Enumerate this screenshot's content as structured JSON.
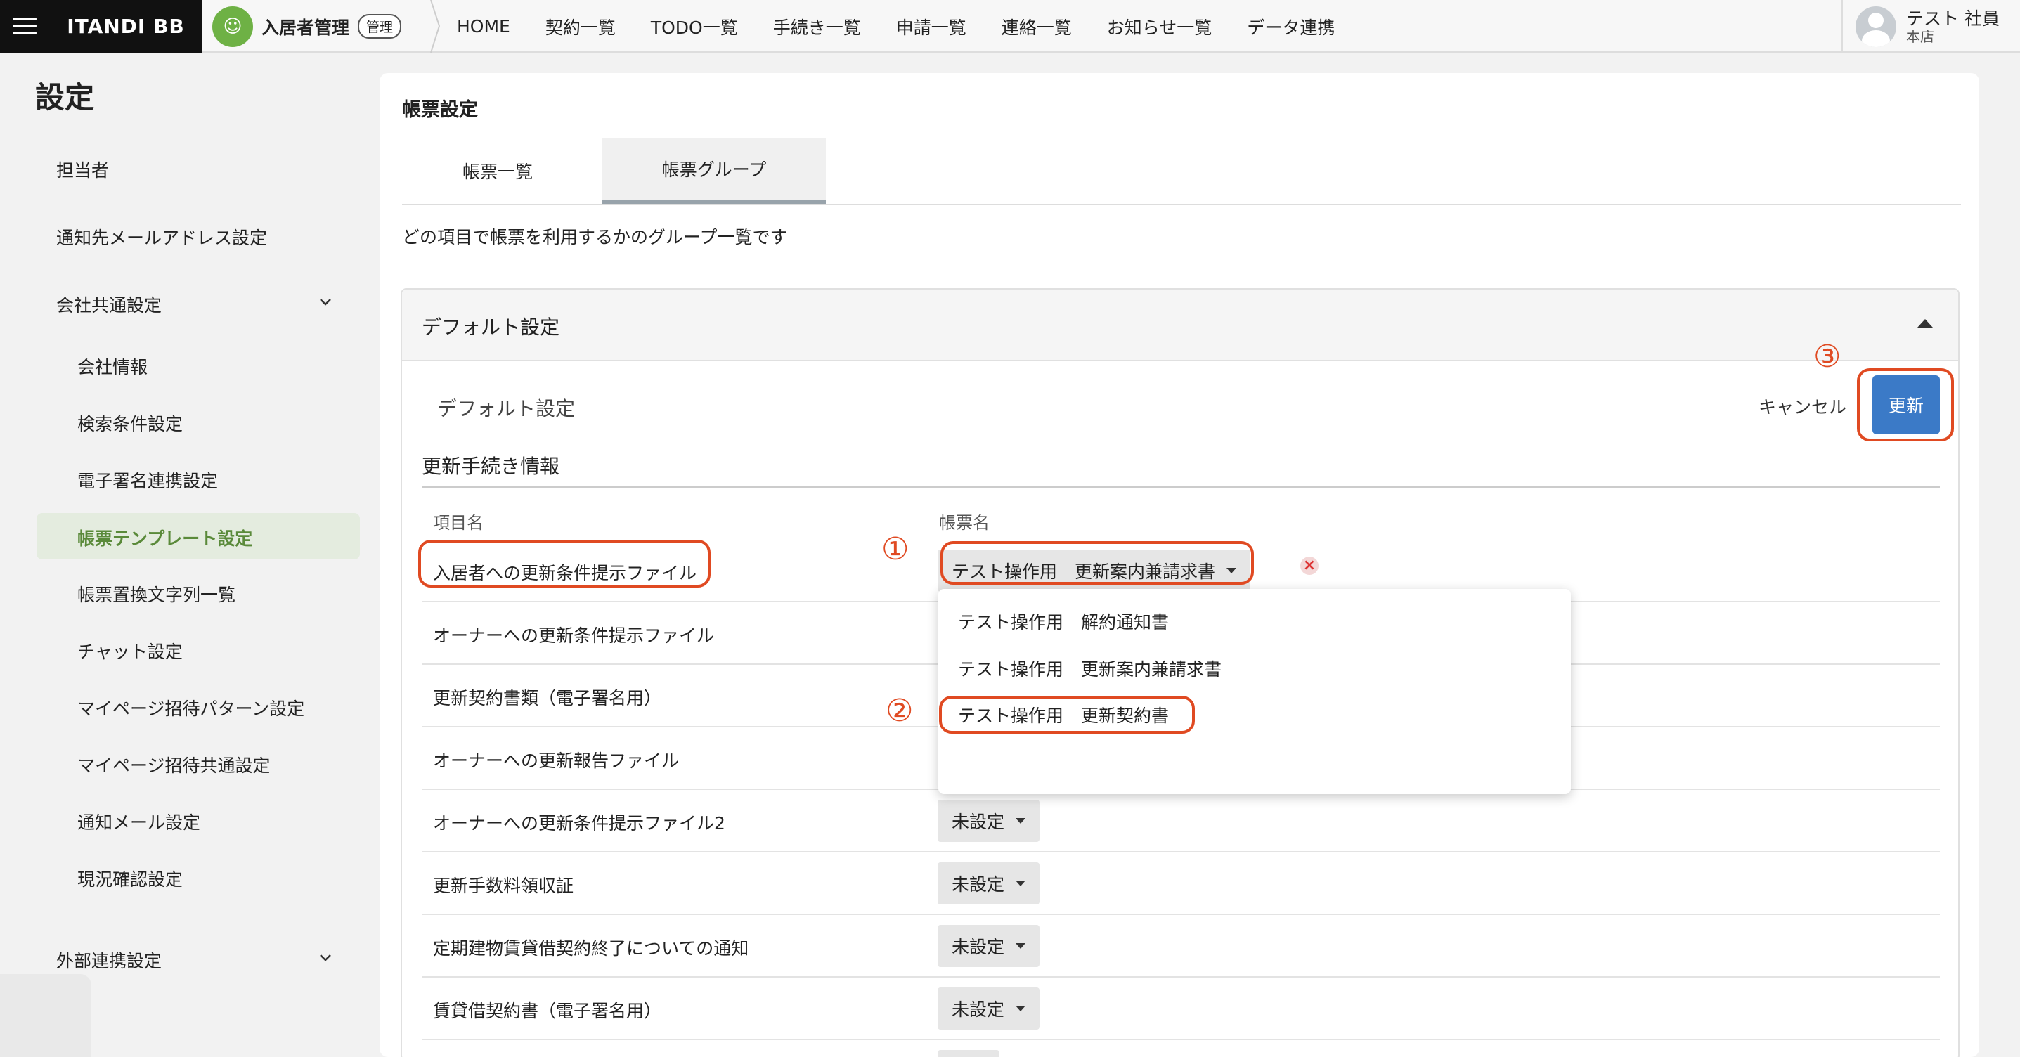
{
  "brand": {
    "logo": "ITANDI BB",
    "service_name": "入居者管理",
    "service_badge": "管理"
  },
  "nav": [
    "HOME",
    "契約一覧",
    "TODO一覧",
    "手続き一覧",
    "申請一覧",
    "連絡一覧",
    "お知らせ一覧",
    "データ連携"
  ],
  "user": {
    "name": "テスト 社員",
    "store": "本店"
  },
  "sidebar": {
    "title": "設定",
    "items": {
      "tantousha": "担当者",
      "mail": "通知先メールアドレス設定",
      "company_group": "会社共通設定",
      "company_info": "会社情報",
      "search": "検索条件設定",
      "esign": "電子署名連携設定",
      "template": "帳票テンプレート設定",
      "replace": "帳票置換文字列一覧",
      "chat": "チャット設定",
      "mypage_pattern": "マイページ招待パターン設定",
      "mypage_common": "マイページ招待共通設定",
      "notify_mail": "通知メール設定",
      "status": "現況確認設定",
      "external_group": "外部連携設定"
    },
    "active_color": "#e4ecdf",
    "active_text_color": "#5a8a3a"
  },
  "main": {
    "title": "帳票設定",
    "tabs": [
      "帳票一覧",
      "帳票グループ"
    ],
    "active_tab": 1,
    "description": "どの項目で帳票を利用するかのグループ一覧です"
  },
  "panel": {
    "title": "デフォルト設定",
    "subtitle": "デフォルト設定",
    "cancel": "キャンセル",
    "update": "更新",
    "section": "更新手続き情報",
    "col_item": "項目名",
    "col_form": "帳票名",
    "rows": [
      {
        "label": "入居者への更新条件提示ファイル",
        "value": "テスト操作用　更新案内兼請求書"
      },
      {
        "label": "オーナーへの更新条件提示ファイル",
        "value": ""
      },
      {
        "label": "更新契約書類（電子署名用）",
        "value": ""
      },
      {
        "label": "オーナーへの更新報告ファイル",
        "value": ""
      },
      {
        "label": "オーナーへの更新条件提示ファイル2",
        "value": "未設定"
      },
      {
        "label": "更新手数料領収証",
        "value": "未設定"
      },
      {
        "label": "定期建物賃貸借契約終了についての通知",
        "value": "未設定"
      },
      {
        "label": "賃貸借契約書（電子署名用）",
        "value": "未設定"
      },
      {
        "label": "",
        "value": ""
      }
    ],
    "clear": "×"
  },
  "dropdown": {
    "options": [
      "テスト操作用　解約通知書",
      "テスト操作用　更新案内兼請求書",
      "テスト操作用　更新契約書"
    ]
  },
  "annotations": {
    "step1": "①",
    "step2": "②",
    "step3": "③",
    "color": "#e04a22"
  },
  "colors": {
    "primary_button": "#3b7ac7",
    "brand_green": "#6eb145"
  }
}
